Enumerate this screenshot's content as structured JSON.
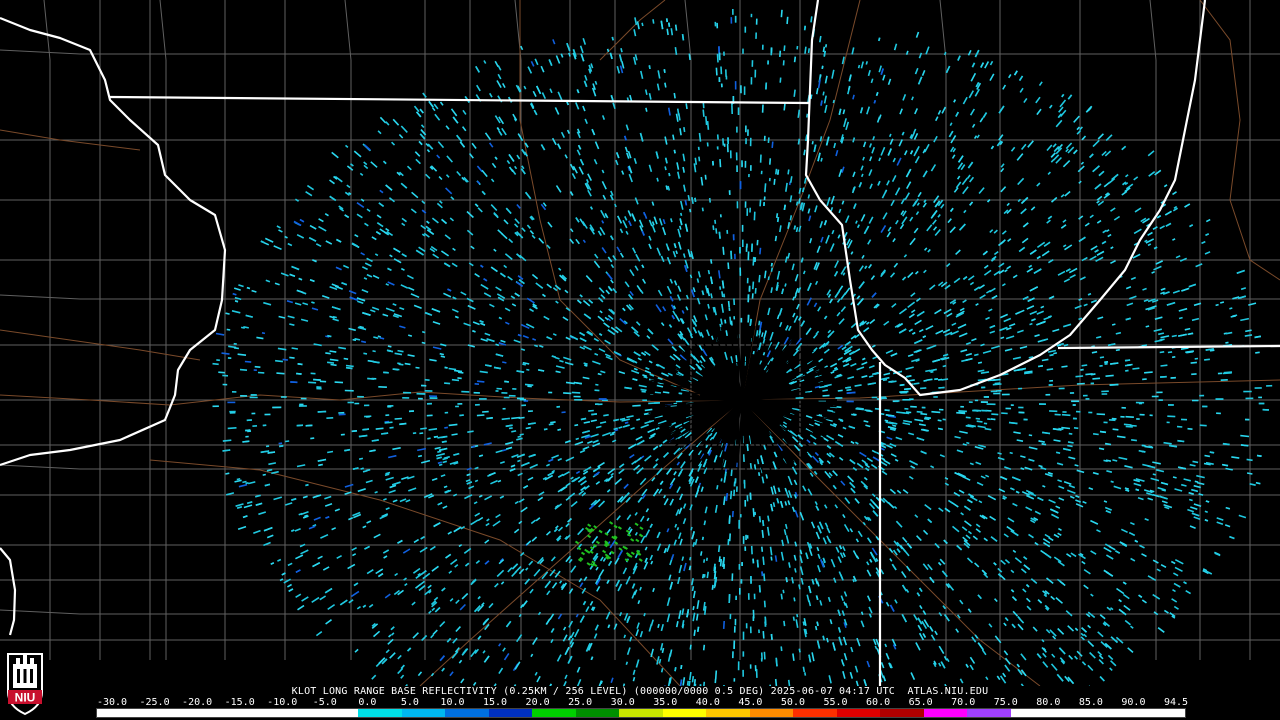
{
  "caption": "KLOT LONG RANGE BASE REFLECTIVITY (0.25KM / 256 LEVEL) (000000/0000 0.5 DEG) 2025-06-07 04:17 UTC  ATLAS.NIU.EDU",
  "logo": {
    "text": "NIU",
    "icon": "niu-tower-logo-icon",
    "color": "#c8102e"
  },
  "scale": {
    "labels": [
      "-30.0",
      "-25.0",
      "-20.0",
      "-15.0",
      "-10.0",
      "-5.0",
      "0.0",
      "5.0",
      "10.0",
      "15.0",
      "20.0",
      "25.0",
      "30.0",
      "35.0",
      "40.0",
      "45.0",
      "50.0",
      "55.0",
      "60.0",
      "65.0",
      "70.0",
      "75.0",
      "80.0",
      "85.0",
      "90.0",
      "94.5"
    ],
    "colors": [
      "#ffffff",
      "#ffffff",
      "#ffffff",
      "#ffffff",
      "#ffffff",
      "#ffffff",
      "#00e0e8",
      "#00b8f0",
      "#0070e0",
      "#0030c0",
      "#00d000",
      "#009000",
      "#c8e600",
      "#ffff00",
      "#ffc800",
      "#ff8c00",
      "#ff3000",
      "#e00000",
      "#b00000",
      "#ff00ff",
      "#a040ff",
      "#ffffff",
      "#ffffff",
      "#ffffff",
      "#ffffff"
    ]
  },
  "colors": {
    "state_border": "#ffffff",
    "county_border": "#606060",
    "road": "#7a4a2a",
    "echo_primary": "#1fc8e0",
    "echo_light": "#2ad8f0",
    "echo_blue": "#1060e0",
    "echo_green": "#20c020"
  }
}
